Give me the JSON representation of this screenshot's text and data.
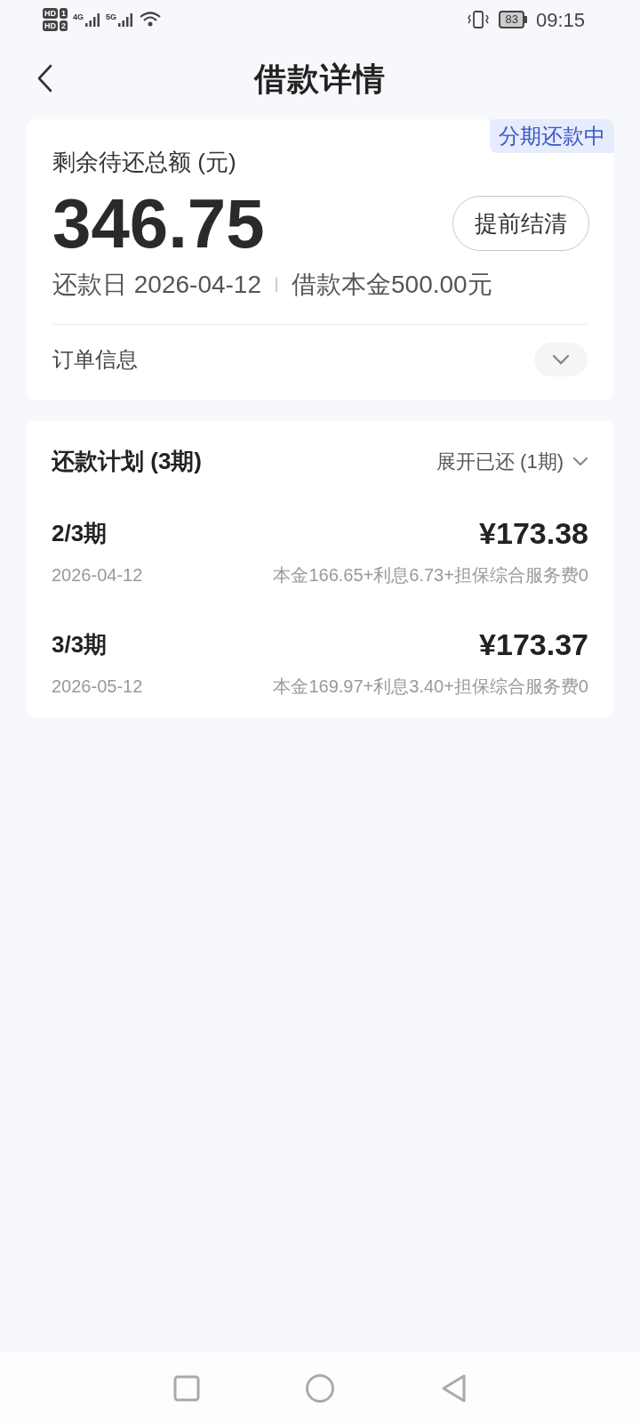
{
  "status_bar": {
    "sims": [
      {
        "badge": "HD",
        "slot": "1"
      },
      {
        "badge": "HD",
        "slot": "2"
      }
    ],
    "networks": [
      "4G",
      "5G"
    ],
    "battery": "83",
    "time": "09:15"
  },
  "header": {
    "title": "借款详情"
  },
  "summary": {
    "tag": "分期还款中",
    "label": "剩余待还总额 (元)",
    "amount": "346.75",
    "settle_button": "提前结清",
    "due_date": "还款日 2026-04-12",
    "principal": "借款本金500.00元",
    "order_info": "订单信息",
    "order_expanded": false
  },
  "plan": {
    "title": "还款计划 (3期)",
    "toggle": "展开已还 (1期)",
    "rows": [
      {
        "period": "2/3期",
        "amount": "¥173.38",
        "date": "2026-04-12",
        "breakdown": "本金166.65+利息6.73+担保综合服务费0"
      },
      {
        "period": "3/3期",
        "amount": "¥173.37",
        "date": "2026-05-12",
        "breakdown": "本金169.97+利息3.40+担保综合服务费0"
      }
    ]
  }
}
